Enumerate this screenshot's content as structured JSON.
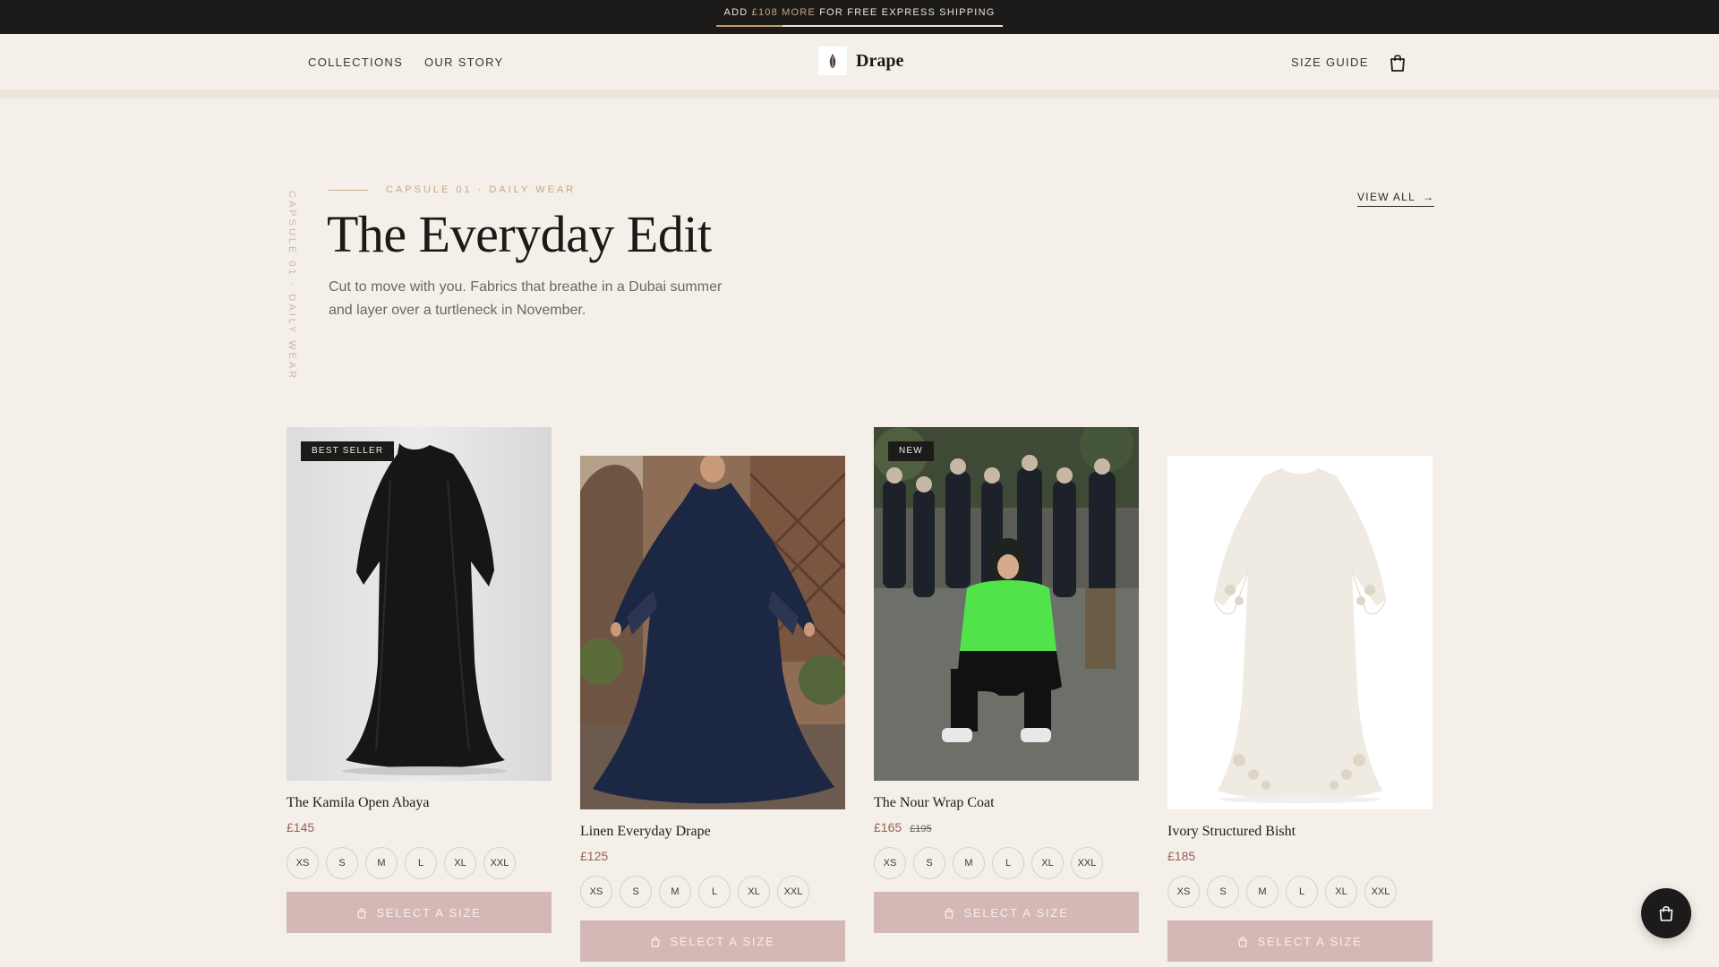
{
  "announcement": {
    "prefix": "ADD ",
    "amount": "£108 MORE",
    "suffix": " FOR FREE EXPRESS SHIPPING",
    "progress": 0.23
  },
  "header": {
    "nav_left": [
      "COLLECTIONS",
      "OUR STORY"
    ],
    "brand": "Drape",
    "size_guide": "SIZE GUIDE",
    "bag_icon": "shopping-bag-icon"
  },
  "hero": {
    "vertical_label": "CAPSULE 01 · DAILY WEAR",
    "eyebrow": "CAPSULE 01 · DAILY WEAR",
    "title": "The Everyday Edit",
    "description": "Cut to move with you. Fabrics that breathe in a Dubai summer and layer over a turtleneck in November.",
    "view_all": "VIEW ALL"
  },
  "products": [
    {
      "badge": "BEST SELLER",
      "name": "The Kamila Open Abaya",
      "price": "£145",
      "original_price": "",
      "sizes": [
        "XS",
        "S",
        "M",
        "L",
        "XL",
        "XXL"
      ],
      "cta": "SELECT A SIZE",
      "image": "black-abaya"
    },
    {
      "badge": "",
      "name": "Linen Everyday Drape",
      "price": "£125",
      "original_price": "",
      "sizes": [
        "XS",
        "S",
        "M",
        "L",
        "XL",
        "XXL"
      ],
      "cta": "SELECT A SIZE",
      "image": "navy-drape"
    },
    {
      "badge": "NEW",
      "name": "The Nour Wrap Coat",
      "price": "£165",
      "original_price": "£195",
      "sizes": [
        "XS",
        "S",
        "M",
        "L",
        "XL",
        "XXL"
      ],
      "cta": "SELECT A SIZE",
      "image": "street-photo"
    },
    {
      "badge": "",
      "name": "Ivory Structured Bisht",
      "price": "£185",
      "original_price": "",
      "sizes": [
        "XS",
        "S",
        "M",
        "L",
        "XL",
        "XXL"
      ],
      "cta": "SELECT A SIZE",
      "image": "ivory-bisht"
    }
  ],
  "colors": {
    "topbar": "#1c1b1a",
    "accent": "#c5a57c",
    "cta": "#d3b8b5",
    "price": "#9a5f56",
    "background": "#f4efe8"
  }
}
